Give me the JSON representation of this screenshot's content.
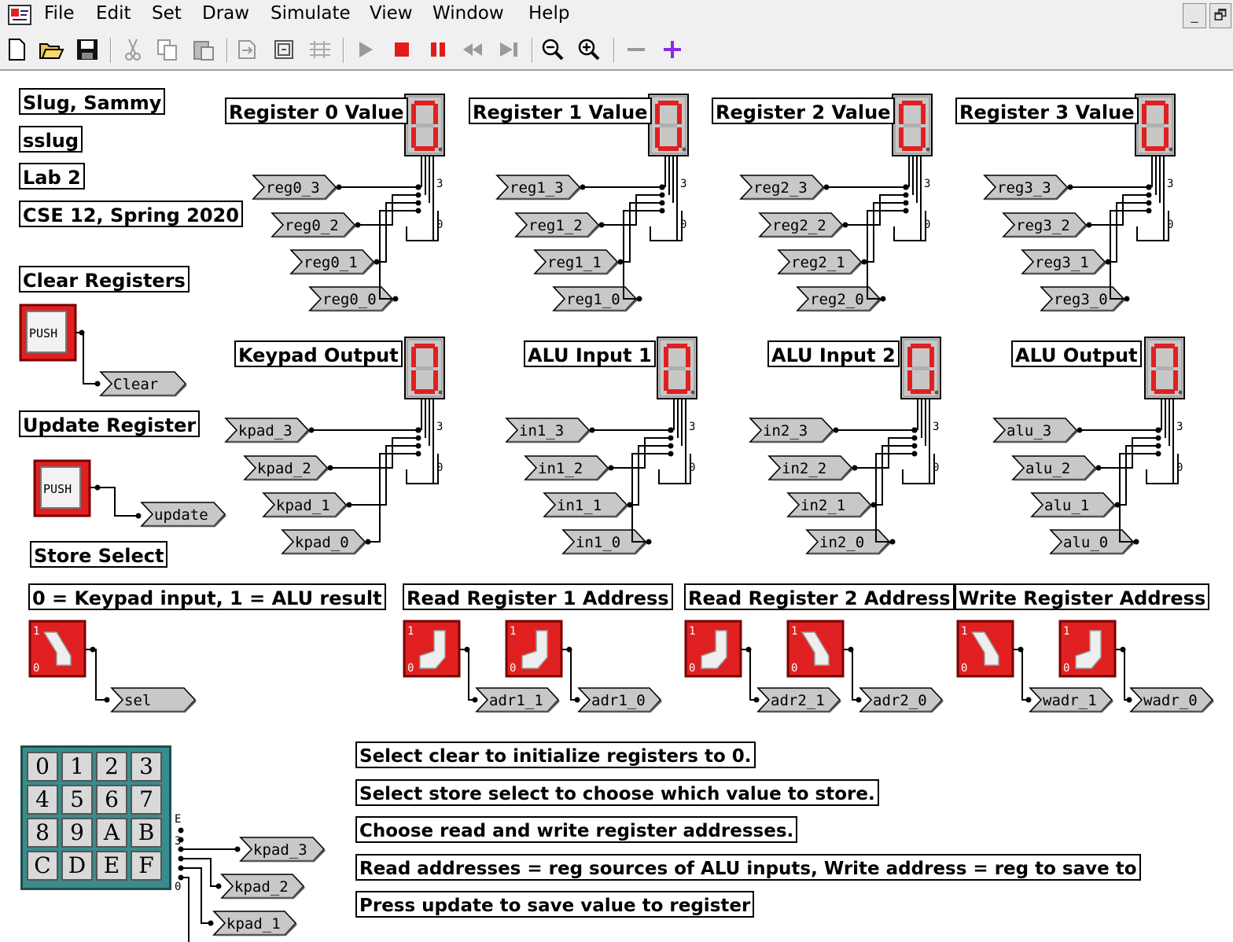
{
  "menu": [
    "File",
    "Edit",
    "Set",
    "Draw",
    "Simulate",
    "View",
    "Window",
    "Help"
  ],
  "window_buttons": {
    "minimize": "_",
    "restore": "🗗"
  },
  "toolbar_icons": [
    "new-file-icon",
    "open-folder-icon",
    "save-icon",
    "cut-icon",
    "copy-icon",
    "paste-icon",
    "import-icon",
    "export-icon",
    "pattern-icon",
    "run-icon",
    "stop-icon",
    "pause-icon",
    "step-back-icon",
    "step-forward-icon",
    "zoom-out-icon",
    "zoom-in-icon",
    "minus-icon",
    "plus-icon"
  ],
  "labels": {
    "name": "Slug, Sammy",
    "username": "sslug",
    "lab": "Lab 2",
    "course": "CSE 12, Spring 2020",
    "clear_registers": "Clear Registers",
    "update_register": "Update Register",
    "store_select": "Store Select",
    "store_select_desc": "0 = Keypad input, 1 = ALU result",
    "read_reg1_addr": "Read Register 1 Address",
    "read_reg2_addr": "Read Register 2 Address",
    "write_reg_addr": "Write Register Address"
  },
  "push_button_text": "PUSH",
  "switch_labels": {
    "one": "1",
    "zero": "0"
  },
  "tap_labels": {
    "three": "3",
    "zero": "0",
    "e": "E"
  },
  "instructions": [
    "Select clear to initialize registers to 0.",
    "Select store select to choose which value to store.",
    "Choose read and write register addresses.",
    "Read addresses = reg sources of ALU inputs, Write address = reg to save to",
    "Press update to save value to register"
  ],
  "displays": [
    {
      "title": "Register 0 Value",
      "wires": [
        "reg0_3",
        "reg0_2",
        "reg0_1",
        "reg0_0"
      ]
    },
    {
      "title": "Register 1 Value",
      "wires": [
        "reg1_3",
        "reg1_2",
        "reg1_1",
        "reg1_0"
      ]
    },
    {
      "title": "Register 2 Value",
      "wires": [
        "reg2_3",
        "reg2_2",
        "reg2_1",
        "reg2_0"
      ]
    },
    {
      "title": "Register 3 Value",
      "wires": [
        "reg3_3",
        "reg3_2",
        "reg3_1",
        "reg3_0"
      ]
    },
    {
      "title": "Keypad Output",
      "wires": [
        "kpad_3",
        "kpad_2",
        "kpad_1",
        "kpad_0"
      ]
    },
    {
      "title": "ALU Input 1",
      "wires": [
        "in1_3",
        "in1_2",
        "in1_1",
        "in1_0"
      ]
    },
    {
      "title": "ALU Input 2",
      "wires": [
        "in2_3",
        "in2_2",
        "in2_1",
        "in2_0"
      ]
    },
    {
      "title": "ALU Output",
      "wires": [
        "alu_3",
        "alu_2",
        "alu_1",
        "alu_0"
      ]
    }
  ],
  "connectors": {
    "clear": "Clear",
    "update": "update",
    "sel": "sel",
    "adr1_1": "adr1_1",
    "adr1_0": "adr1_0",
    "adr2_1": "adr2_1",
    "adr2_0": "adr2_0",
    "wadr_1": "wadr_1",
    "wadr_0": "wadr_0",
    "keypad_out": [
      "kpad_3",
      "kpad_2",
      "kpad_1"
    ]
  },
  "keypad_keys": [
    "0",
    "1",
    "2",
    "3",
    "4",
    "5",
    "6",
    "7",
    "8",
    "9",
    "A",
    "B",
    "C",
    "D",
    "E",
    "F"
  ],
  "colors": {
    "red": "#e02020",
    "dark_red": "#7a0000",
    "connector_fill": "#c8c8c8",
    "keypad_teal": "#3a8c8c",
    "display_bg": "#c7c7c7"
  }
}
